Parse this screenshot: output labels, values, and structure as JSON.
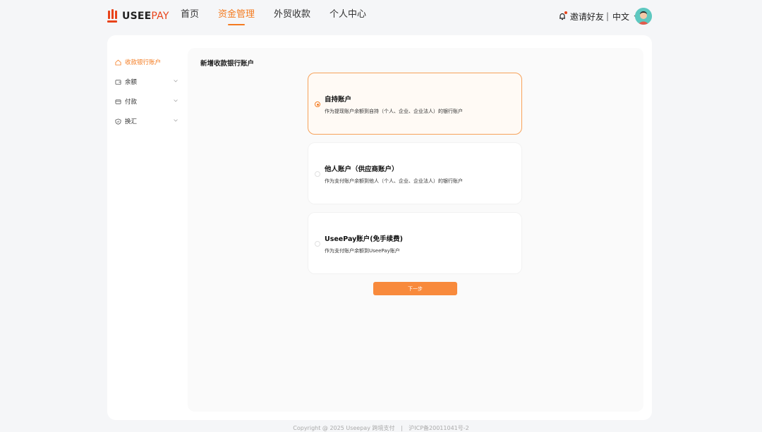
{
  "logo": {
    "text_main": "USEE",
    "text_accent": "PAY"
  },
  "nav": [
    {
      "label": "首页",
      "active": false
    },
    {
      "label": "资金管理",
      "active": true
    },
    {
      "label": "外贸收款",
      "active": false
    },
    {
      "label": "个人中心",
      "active": false
    }
  ],
  "header_right": {
    "invite_label": "邀请好友",
    "separator": "|",
    "language": "中文"
  },
  "sidebar": {
    "items": [
      {
        "label": "收款银行账户",
        "icon": "home-icon",
        "active": true
      },
      {
        "label": "余额",
        "icon": "wallet-icon",
        "active": false
      },
      {
        "label": "付款",
        "icon": "card-icon",
        "active": false
      },
      {
        "label": "换汇",
        "icon": "shield-icon",
        "active": false
      }
    ]
  },
  "main": {
    "title": "新增收款银行账户",
    "options": [
      {
        "title": "自持账户",
        "desc": "作为提现账户余额到自持（个人、企业、企业法人）的银行账户",
        "selected": true
      },
      {
        "title": "他人账户（供应商账户）",
        "desc": "作为支付账户余额到他人（个人、企业、企业法人）的银行账户",
        "selected": false
      },
      {
        "title": "UseePay账户(免手续费)",
        "desc": "作为支付账户余额到UseePay账户",
        "selected": false
      }
    ],
    "next_button": "下一步"
  },
  "footer": {
    "copyright": "Copyright @ 2025 Useepay 跨境支付",
    "separator": "|",
    "icp": "沪ICP备20011041号-2"
  },
  "colors": {
    "accent": "#f47b20",
    "brand_red": "#e8431a",
    "button": "#f88a3c"
  }
}
